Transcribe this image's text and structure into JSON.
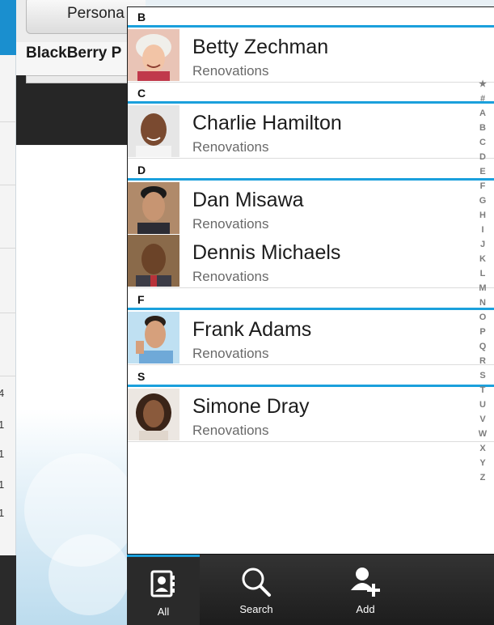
{
  "background": {
    "left_numbers": [
      "4",
      "1",
      "1",
      "1",
      "1"
    ],
    "middle_tab_label": "Persona",
    "middle_title": "BlackBerry P"
  },
  "sections": [
    {
      "letter": "B",
      "contacts": [
        {
          "name": "Betty Zechman",
          "company": "Renovations"
        }
      ]
    },
    {
      "letter": "C",
      "contacts": [
        {
          "name": "Charlie Hamilton",
          "company": "Renovations"
        }
      ]
    },
    {
      "letter": "D",
      "contacts": [
        {
          "name": "Dan Misawa",
          "company": "Renovations"
        },
        {
          "name": "Dennis Michaels",
          "company": "Renovations"
        }
      ]
    },
    {
      "letter": "F",
      "contacts": [
        {
          "name": "Frank Adams",
          "company": "Renovations"
        }
      ]
    },
    {
      "letter": "S",
      "contacts": [
        {
          "name": "Simone Dray",
          "company": "Renovations"
        }
      ]
    }
  ],
  "index_letters": [
    "★",
    "#",
    "A",
    "B",
    "C",
    "D",
    "E",
    "F",
    "G",
    "H",
    "I",
    "J",
    "K",
    "L",
    "M",
    "N",
    "O",
    "P",
    "Q",
    "R",
    "S",
    "T",
    "U",
    "V",
    "W",
    "X",
    "Y",
    "Z"
  ],
  "actions": {
    "all_label": "All",
    "search_label": "Search",
    "add_label": "Add"
  },
  "colors": {
    "accent": "#1ba0dc",
    "action_bar": "#262626"
  },
  "icons": {
    "all": "contacts-book-icon",
    "search": "search-icon",
    "add": "add-contact-icon",
    "overflow": "overflow-menu-icon"
  }
}
